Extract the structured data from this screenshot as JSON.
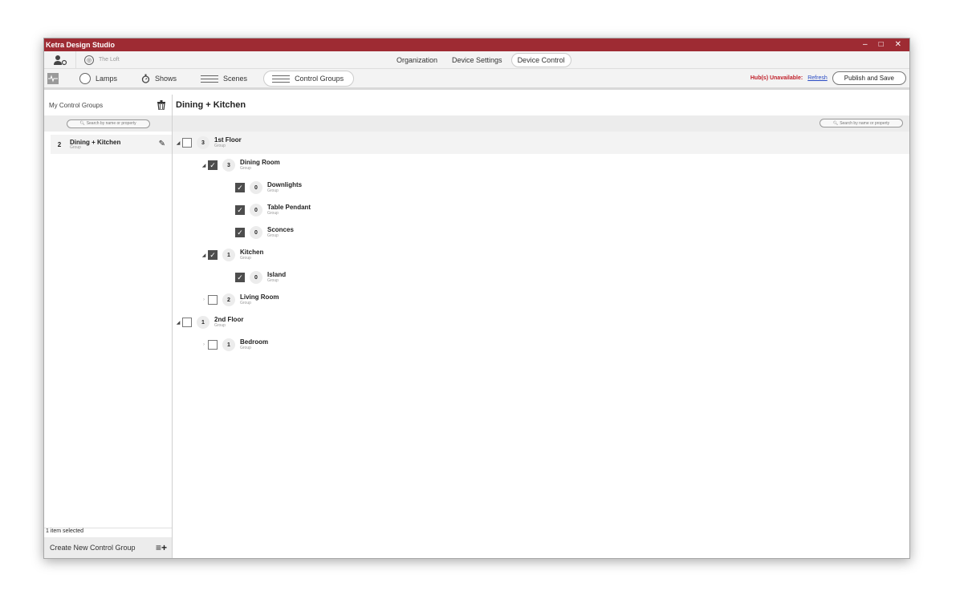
{
  "app": {
    "title": "Ketra Design Studio",
    "minimize": "–",
    "maximize": "□",
    "close": "✕"
  },
  "topbar": {
    "site": "The Loft",
    "tabs": [
      {
        "label": "Organization"
      },
      {
        "label": "Device Settings"
      },
      {
        "label": "Device Control"
      }
    ]
  },
  "subbar": {
    "tabs": [
      {
        "label": "Lamps"
      },
      {
        "label": "Shows"
      },
      {
        "label": "Scenes"
      },
      {
        "label": "Control Groups"
      }
    ],
    "hub_warning": "Hub(s) Unavailable:",
    "refresh": "Refresh",
    "publish": "Publish and Save"
  },
  "sidebar": {
    "title": "My Control Groups",
    "search_placeholder": "Search by name or property",
    "items": [
      {
        "count": "2",
        "name": "Dining + Kitchen",
        "sub": "Group"
      }
    ],
    "selected_count": "1 item selected",
    "create_label": "Create New Control Group",
    "create_icon": "≡+"
  },
  "main": {
    "title": "Dining + Kitchen",
    "search_placeholder": "Search by name or property",
    "tree": [
      {
        "name": "1st Floor",
        "sub": "Group",
        "count": "3"
      },
      {
        "name": "Dining Room",
        "sub": "Group",
        "count": "3"
      },
      {
        "name": "Downlights",
        "sub": "Group",
        "count": "0"
      },
      {
        "name": "Table Pendant",
        "sub": "Group",
        "count": "0"
      },
      {
        "name": "Sconces",
        "sub": "Group",
        "count": "0"
      },
      {
        "name": "Kitchen",
        "sub": "Group",
        "count": "1"
      },
      {
        "name": "Island",
        "sub": "Group",
        "count": "0"
      },
      {
        "name": "Living Room",
        "sub": "Group",
        "count": "2"
      },
      {
        "name": "2nd Floor",
        "sub": "Group",
        "count": "1"
      },
      {
        "name": "Bedroom",
        "sub": "Group",
        "count": "1"
      }
    ]
  }
}
